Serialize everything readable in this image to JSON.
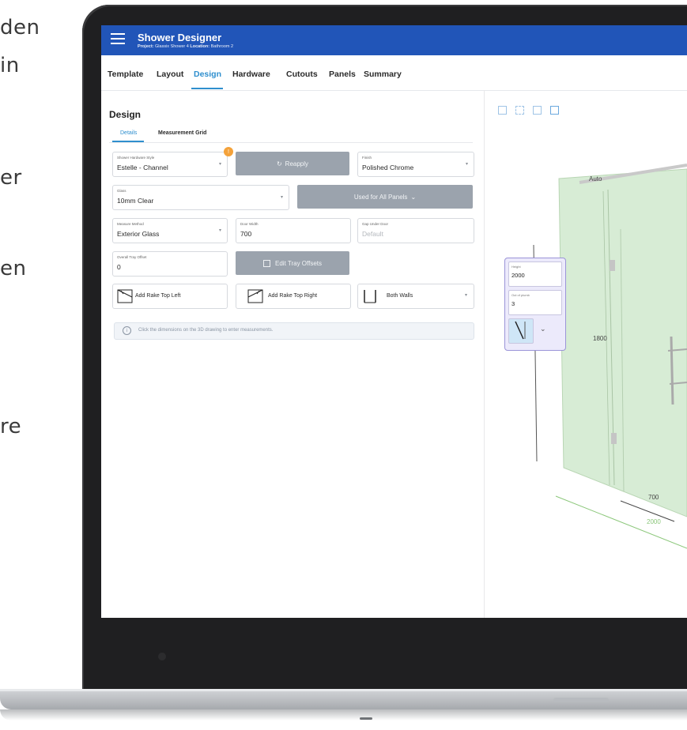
{
  "side_text": [
    "den",
    "in",
    "er",
    "en",
    "re"
  ],
  "app": {
    "title": "Shower Designer",
    "project_label": "Project:",
    "project_value": "Glassix Shower 4",
    "location_label": "Location:",
    "location_value": "Bathroom 2"
  },
  "tabs": [
    "Template",
    "Layout",
    "Design",
    "Hardware",
    "Cutouts",
    "Panels",
    "Summary"
  ],
  "active_tab": "Design",
  "design": {
    "title": "Design",
    "subtabs": [
      "Details",
      "Measurement Grid"
    ],
    "hardware_style": {
      "label": "Shower Hardware Style",
      "value": "Estelle - Channel"
    },
    "badge": "!",
    "reapply_label": "Reapply",
    "finish": {
      "label": "Finish",
      "value": "Polished Chrome"
    },
    "glass": {
      "label": "Glass",
      "value": "10mm Clear"
    },
    "used_for_all_label": "Used for All Panels",
    "measure_method": {
      "label": "Measure Method",
      "value": "Exterior Glass"
    },
    "door_width": {
      "label": "Door Width",
      "value": "700"
    },
    "gap_under_door": {
      "label": "Gap Under Door",
      "placeholder": "Default"
    },
    "overall_tray_offset": {
      "label": "Overall Tray Offset",
      "value": "0"
    },
    "edit_tray_offsets_label": "Edit Tray Offsets",
    "rake_left_label": "Add Rake Top Left",
    "rake_right_label": "Add Rake Top Right",
    "walls": {
      "value": "Both Walls"
    },
    "info_text": "Click the dimensions on the 3D drawing to enter measurements."
  },
  "view3d": {
    "height": {
      "label": "Height",
      "value": "2000"
    },
    "out_of_plumb": {
      "label": "Out of plumb",
      "value": "3"
    },
    "dims": {
      "auto": "Auto",
      "d1800": "1800",
      "d700": "700",
      "d2000": "2000"
    }
  },
  "colors": {
    "appbar": "#2155b8",
    "accent": "#2f8fce",
    "button": "#9ba3ad",
    "glass": "#d7ecd5",
    "badge": "#f4a23a"
  }
}
